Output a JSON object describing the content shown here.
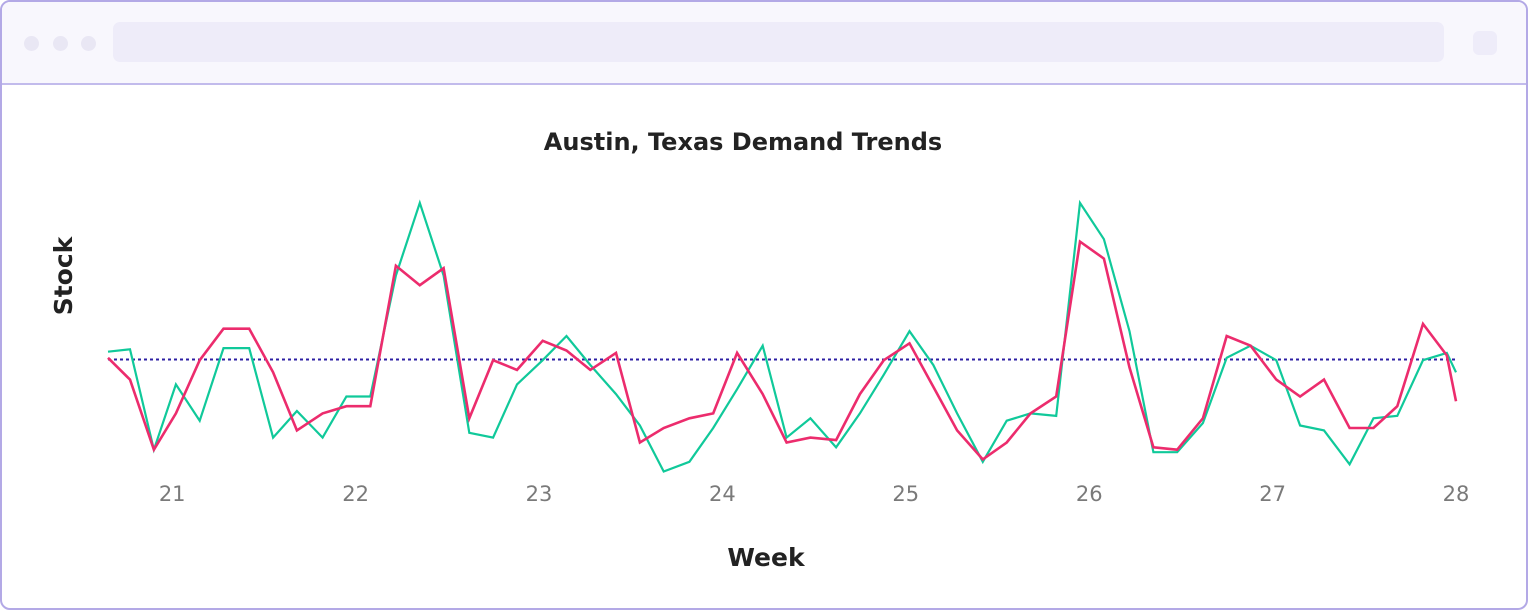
{
  "window": {
    "controls": [
      "close",
      "minimize",
      "maximize"
    ],
    "address_bar_text": ""
  },
  "chart_data": {
    "type": "line",
    "title": "Austin, Texas Demand Trends",
    "xlabel": "Week",
    "ylabel": "Stock",
    "xlim": [
      20.65,
      28
    ],
    "ylim": [
      0,
      10
    ],
    "xticks": [
      21,
      22,
      23,
      24,
      25,
      26,
      27,
      28
    ],
    "show_y_ticks": false,
    "grid": false,
    "legend": "none",
    "reference_line": {
      "y": 4.03,
      "style": "dotted",
      "color": "#2d1fa3"
    },
    "x": [
      20.65,
      20.77,
      20.9,
      21.02,
      21.15,
      21.28,
      21.42,
      21.55,
      21.68,
      21.82,
      21.95,
      22.08,
      22.22,
      22.35,
      22.48,
      22.62,
      22.75,
      22.88,
      23.02,
      23.15,
      23.28,
      23.42,
      23.55,
      23.68,
      23.82,
      23.95,
      24.08,
      24.22,
      24.35,
      24.48,
      24.62,
      24.75,
      24.88,
      25.02,
      25.15,
      25.28,
      25.42,
      25.55,
      25.68,
      25.82,
      25.95,
      26.08,
      26.22,
      26.35,
      26.48,
      26.62,
      26.75,
      26.88,
      27.02,
      27.15,
      27.28,
      27.42,
      27.55,
      27.68,
      27.82,
      27.95,
      28.0
    ],
    "series": [
      {
        "color": "#10c99a",
        "values": [
          4.35,
          4.45,
          0.3,
          3.0,
          1.5,
          4.5,
          4.5,
          0.8,
          1.9,
          0.8,
          2.5,
          2.5,
          7.5,
          10.5,
          7.5,
          1.0,
          0.8,
          3.0,
          4.0,
          5.0,
          3.8,
          2.6,
          1.3,
          -0.6,
          -0.2,
          1.2,
          2.8,
          4.6,
          0.8,
          1.6,
          0.4,
          1.8,
          3.4,
          5.2,
          3.8,
          1.8,
          -0.2,
          1.5,
          1.8,
          1.7,
          10.5,
          9.0,
          5.2,
          0.2,
          0.2,
          1.4,
          4.1,
          4.6,
          4.0,
          1.3,
          1.1,
          -0.3,
          1.6,
          1.7,
          4.0,
          4.3,
          3.5
        ]
      },
      {
        "color": "#ec2c6d",
        "values": [
          4.1,
          3.2,
          0.3,
          1.8,
          4.0,
          5.3,
          5.3,
          3.5,
          1.1,
          1.8,
          2.1,
          2.1,
          7.9,
          7.1,
          7.8,
          1.6,
          4.0,
          3.6,
          4.8,
          4.4,
          3.6,
          4.3,
          0.6,
          1.2,
          1.6,
          1.8,
          4.3,
          2.6,
          0.6,
          0.8,
          0.7,
          2.6,
          4.0,
          4.7,
          2.9,
          1.1,
          -0.1,
          0.6,
          1.8,
          2.5,
          8.9,
          8.2,
          3.7,
          0.4,
          0.3,
          1.6,
          5.0,
          4.6,
          3.2,
          2.5,
          3.2,
          1.2,
          1.2,
          2.1,
          5.5,
          4.2,
          2.3
        ]
      }
    ]
  }
}
